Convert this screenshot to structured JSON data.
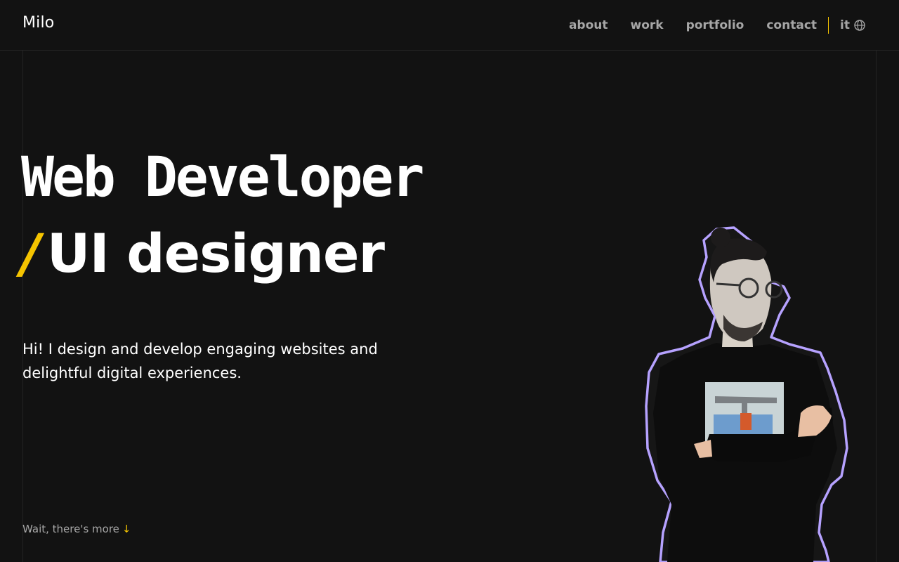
{
  "header": {
    "logo": "Milo",
    "nav": [
      {
        "label": "about"
      },
      {
        "label": "work"
      },
      {
        "label": "portfolio"
      },
      {
        "label": "contact"
      }
    ],
    "language": "it",
    "language_icon": "globe-icon"
  },
  "hero": {
    "line1": "Web Developer",
    "slash": "/",
    "line2": "UI designer",
    "intro": "Hi! I design and develop engaging websites and delightful digital experiences.",
    "more_label": "Wait, there's more",
    "more_arrow": "↓"
  },
  "colors": {
    "background": "#121212",
    "accent": "#f5c400",
    "outline": "#b6a2ff",
    "muted_text": "#a6a6a6"
  }
}
